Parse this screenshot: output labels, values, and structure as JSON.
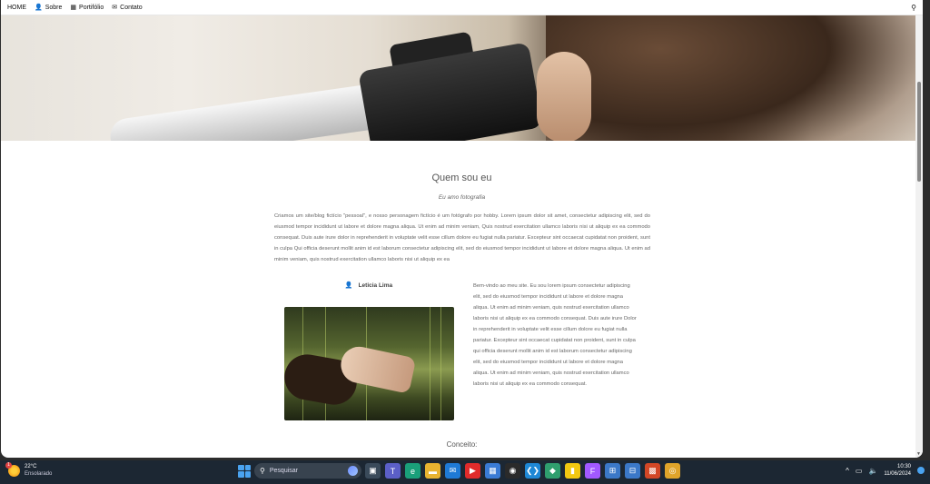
{
  "nav": {
    "items": [
      {
        "label": "HOME",
        "icon": ""
      },
      {
        "label": "Sobre",
        "icon": "user-icon"
      },
      {
        "label": "Portifólio",
        "icon": "grid-icon"
      },
      {
        "label": "Contato",
        "icon": "envelope-icon"
      }
    ],
    "search_icon": "search-icon"
  },
  "about": {
    "title": "Quem sou eu",
    "subtitle": "Eu amo fotografia",
    "paragraph": "Criamos um site/blog fictício \"pessoal\", e nosso personagem fictício é um fotógrafo por hobby. Lorem ipsum dolor sit amet, consectetur adipiscing elit, sed do eiusmod tempor incididunt ut labore et dolore magna aliqua. Ut enim ad minim veniam, Quis nostrud exercitation ullamco laboris nisi ut aliquip ex ea commodo consequat. Duis aute irure dolor in reprehenderit in voluptate velit esse cillum dolore eu fugiat nulla pariatur. Excepteur sint occaecat cupidatat non proident, sunt in culpa Qui officia deserunt mollit anim id est laborum consectetur adipiscing elit, sed do eiusmod tempor incididunt ut labore et dolore magna aliqua. Ut enim ad minim veniam, quis nostrud exercitation ullamco laboris nisi ut aliquip ex ea",
    "author_name": "Leticia Lima",
    "bio": "Bem-vindo ao meu site. Eu sou lorem ipsum consectetur adipiscing elit, sed do eiusmod tempor incididunt ut labore et dolore magna aliqua. Ut enim ad minim veniam, quis nostrud exercitation ullamco laboris nisi ut aliquip ex ea commodo consequat. Duis aute irure Dolor in reprehenderit in voluptate velit esse cillum dolore eu fugiat nulla pariatur. Excepteur sint occaecat cupidatat non proident, sunt in culpa qui officia deserunt mollit anim id est laborum consectetur adipiscing elit, sed do eiusmod tempor incididunt ut labore et dolore magna aliqua. Ut enim ad minim veniam, quis nostrud exercitation ullamco laboris nisi ut aliquip ex ea commodo consequat."
  },
  "concept": {
    "title": "Conceito:"
  },
  "taskbar": {
    "weather": {
      "temp": "22°C",
      "condition": "Ensolarado",
      "badge": "1"
    },
    "search_label": "Pesquisar",
    "apps": [
      {
        "name": "task-view-icon",
        "color": "#3a4a5a",
        "glyph": "▣"
      },
      {
        "name": "teams-icon",
        "color": "#5b5fc7",
        "glyph": "T"
      },
      {
        "name": "edge-icon",
        "color": "#1aa07a",
        "glyph": "e"
      },
      {
        "name": "file-explorer-icon",
        "color": "#e8b330",
        "glyph": "▬"
      },
      {
        "name": "mail-icon",
        "color": "#1f7ad6",
        "glyph": "✉"
      },
      {
        "name": "youtube-icon",
        "color": "#e02b2b",
        "glyph": "▶"
      },
      {
        "name": "store-icon",
        "color": "#3a7bd5",
        "glyph": "▦"
      },
      {
        "name": "app-ring-icon",
        "color": "#2a2a2a",
        "glyph": "◉"
      },
      {
        "name": "vscode-icon",
        "color": "#1e88d6",
        "glyph": "❮❯"
      },
      {
        "name": "copilot-icon",
        "color": "#2f9e6e",
        "glyph": "◆"
      },
      {
        "name": "powerbi-icon",
        "color": "#f2c811",
        "glyph": "▮"
      },
      {
        "name": "figma-icon",
        "color": "#a259ff",
        "glyph": "F"
      },
      {
        "name": "remote-desktop-icon",
        "color": "#3b78c8",
        "glyph": "⊞"
      },
      {
        "name": "remote-desktop-2-icon",
        "color": "#3b78c8",
        "glyph": "⊟"
      },
      {
        "name": "office-icon",
        "color": "#d24726",
        "glyph": "▩"
      },
      {
        "name": "chrome-icon",
        "color": "#e0a42a",
        "glyph": "◎"
      }
    ],
    "clock": {
      "time": "10:30",
      "date": "11/06/2024"
    }
  }
}
